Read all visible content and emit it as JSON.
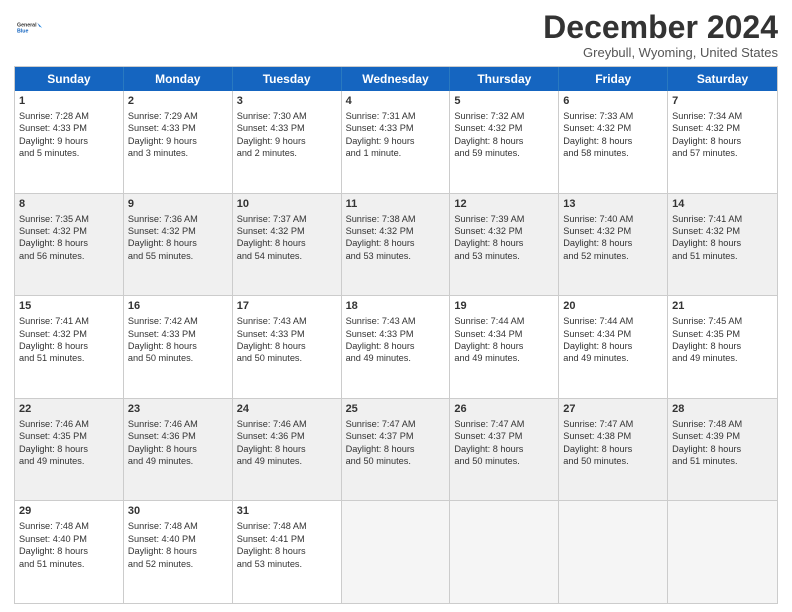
{
  "logo": {
    "line1": "General",
    "line2": "Blue"
  },
  "title": "December 2024",
  "subtitle": "Greybull, Wyoming, United States",
  "headers": [
    "Sunday",
    "Monday",
    "Tuesday",
    "Wednesday",
    "Thursday",
    "Friday",
    "Saturday"
  ],
  "weeks": [
    [
      {
        "day": "1",
        "lines": [
          "Sunrise: 7:28 AM",
          "Sunset: 4:33 PM",
          "Daylight: 9 hours",
          "and 5 minutes."
        ],
        "shade": false
      },
      {
        "day": "2",
        "lines": [
          "Sunrise: 7:29 AM",
          "Sunset: 4:33 PM",
          "Daylight: 9 hours",
          "and 3 minutes."
        ],
        "shade": false
      },
      {
        "day": "3",
        "lines": [
          "Sunrise: 7:30 AM",
          "Sunset: 4:33 PM",
          "Daylight: 9 hours",
          "and 2 minutes."
        ],
        "shade": false
      },
      {
        "day": "4",
        "lines": [
          "Sunrise: 7:31 AM",
          "Sunset: 4:33 PM",
          "Daylight: 9 hours",
          "and 1 minute."
        ],
        "shade": false
      },
      {
        "day": "5",
        "lines": [
          "Sunrise: 7:32 AM",
          "Sunset: 4:32 PM",
          "Daylight: 8 hours",
          "and 59 minutes."
        ],
        "shade": false
      },
      {
        "day": "6",
        "lines": [
          "Sunrise: 7:33 AM",
          "Sunset: 4:32 PM",
          "Daylight: 8 hours",
          "and 58 minutes."
        ],
        "shade": false
      },
      {
        "day": "7",
        "lines": [
          "Sunrise: 7:34 AM",
          "Sunset: 4:32 PM",
          "Daylight: 8 hours",
          "and 57 minutes."
        ],
        "shade": false
      }
    ],
    [
      {
        "day": "8",
        "lines": [
          "Sunrise: 7:35 AM",
          "Sunset: 4:32 PM",
          "Daylight: 8 hours",
          "and 56 minutes."
        ],
        "shade": true
      },
      {
        "day": "9",
        "lines": [
          "Sunrise: 7:36 AM",
          "Sunset: 4:32 PM",
          "Daylight: 8 hours",
          "and 55 minutes."
        ],
        "shade": true
      },
      {
        "day": "10",
        "lines": [
          "Sunrise: 7:37 AM",
          "Sunset: 4:32 PM",
          "Daylight: 8 hours",
          "and 54 minutes."
        ],
        "shade": true
      },
      {
        "day": "11",
        "lines": [
          "Sunrise: 7:38 AM",
          "Sunset: 4:32 PM",
          "Daylight: 8 hours",
          "and 53 minutes."
        ],
        "shade": true
      },
      {
        "day": "12",
        "lines": [
          "Sunrise: 7:39 AM",
          "Sunset: 4:32 PM",
          "Daylight: 8 hours",
          "and 53 minutes."
        ],
        "shade": true
      },
      {
        "day": "13",
        "lines": [
          "Sunrise: 7:40 AM",
          "Sunset: 4:32 PM",
          "Daylight: 8 hours",
          "and 52 minutes."
        ],
        "shade": true
      },
      {
        "day": "14",
        "lines": [
          "Sunrise: 7:41 AM",
          "Sunset: 4:32 PM",
          "Daylight: 8 hours",
          "and 51 minutes."
        ],
        "shade": true
      }
    ],
    [
      {
        "day": "15",
        "lines": [
          "Sunrise: 7:41 AM",
          "Sunset: 4:32 PM",
          "Daylight: 8 hours",
          "and 51 minutes."
        ],
        "shade": false
      },
      {
        "day": "16",
        "lines": [
          "Sunrise: 7:42 AM",
          "Sunset: 4:33 PM",
          "Daylight: 8 hours",
          "and 50 minutes."
        ],
        "shade": false
      },
      {
        "day": "17",
        "lines": [
          "Sunrise: 7:43 AM",
          "Sunset: 4:33 PM",
          "Daylight: 8 hours",
          "and 50 minutes."
        ],
        "shade": false
      },
      {
        "day": "18",
        "lines": [
          "Sunrise: 7:43 AM",
          "Sunset: 4:33 PM",
          "Daylight: 8 hours",
          "and 49 minutes."
        ],
        "shade": false
      },
      {
        "day": "19",
        "lines": [
          "Sunrise: 7:44 AM",
          "Sunset: 4:34 PM",
          "Daylight: 8 hours",
          "and 49 minutes."
        ],
        "shade": false
      },
      {
        "day": "20",
        "lines": [
          "Sunrise: 7:44 AM",
          "Sunset: 4:34 PM",
          "Daylight: 8 hours",
          "and 49 minutes."
        ],
        "shade": false
      },
      {
        "day": "21",
        "lines": [
          "Sunrise: 7:45 AM",
          "Sunset: 4:35 PM",
          "Daylight: 8 hours",
          "and 49 minutes."
        ],
        "shade": false
      }
    ],
    [
      {
        "day": "22",
        "lines": [
          "Sunrise: 7:46 AM",
          "Sunset: 4:35 PM",
          "Daylight: 8 hours",
          "and 49 minutes."
        ],
        "shade": true
      },
      {
        "day": "23",
        "lines": [
          "Sunrise: 7:46 AM",
          "Sunset: 4:36 PM",
          "Daylight: 8 hours",
          "and 49 minutes."
        ],
        "shade": true
      },
      {
        "day": "24",
        "lines": [
          "Sunrise: 7:46 AM",
          "Sunset: 4:36 PM",
          "Daylight: 8 hours",
          "and 49 minutes."
        ],
        "shade": true
      },
      {
        "day": "25",
        "lines": [
          "Sunrise: 7:47 AM",
          "Sunset: 4:37 PM",
          "Daylight: 8 hours",
          "and 50 minutes."
        ],
        "shade": true
      },
      {
        "day": "26",
        "lines": [
          "Sunrise: 7:47 AM",
          "Sunset: 4:37 PM",
          "Daylight: 8 hours",
          "and 50 minutes."
        ],
        "shade": true
      },
      {
        "day": "27",
        "lines": [
          "Sunrise: 7:47 AM",
          "Sunset: 4:38 PM",
          "Daylight: 8 hours",
          "and 50 minutes."
        ],
        "shade": true
      },
      {
        "day": "28",
        "lines": [
          "Sunrise: 7:48 AM",
          "Sunset: 4:39 PM",
          "Daylight: 8 hours",
          "and 51 minutes."
        ],
        "shade": true
      }
    ],
    [
      {
        "day": "29",
        "lines": [
          "Sunrise: 7:48 AM",
          "Sunset: 4:40 PM",
          "Daylight: 8 hours",
          "and 51 minutes."
        ],
        "shade": false
      },
      {
        "day": "30",
        "lines": [
          "Sunrise: 7:48 AM",
          "Sunset: 4:40 PM",
          "Daylight: 8 hours",
          "and 52 minutes."
        ],
        "shade": false
      },
      {
        "day": "31",
        "lines": [
          "Sunrise: 7:48 AM",
          "Sunset: 4:41 PM",
          "Daylight: 8 hours",
          "and 53 minutes."
        ],
        "shade": false
      },
      {
        "day": "",
        "lines": [],
        "shade": false,
        "empty": true
      },
      {
        "day": "",
        "lines": [],
        "shade": false,
        "empty": true
      },
      {
        "day": "",
        "lines": [],
        "shade": false,
        "empty": true
      },
      {
        "day": "",
        "lines": [],
        "shade": false,
        "empty": true
      }
    ]
  ]
}
